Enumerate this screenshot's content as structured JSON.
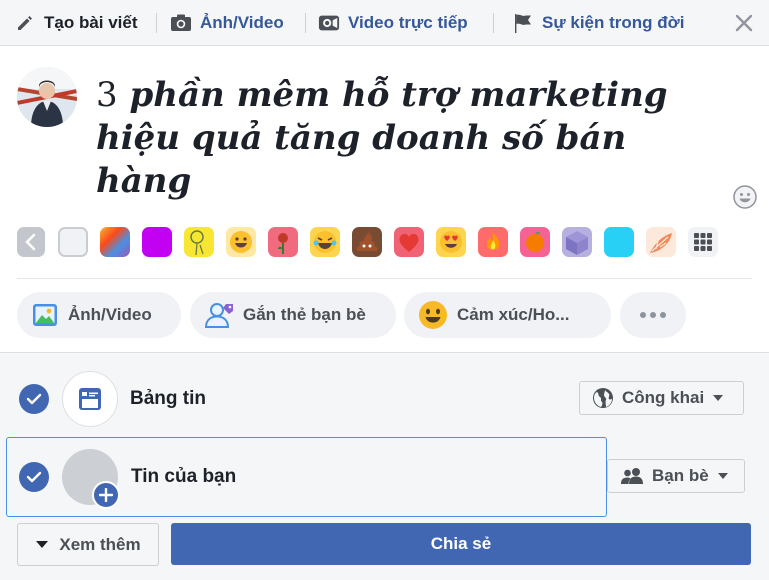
{
  "tabs": {
    "create_post": "Tạo bài viết",
    "photo_video": "Ảnh/Video",
    "live_video": "Video trực tiếp",
    "life_event": "Sự kiện trong đời"
  },
  "post": {
    "number": "3",
    "text": "phần mêm hỗ trợ marketing hiệu quả tăng doanh số bán hàng"
  },
  "backgrounds": [
    "back-arrow",
    "plain-white",
    "colorful-wave",
    "purple",
    "yellow-balloon",
    "smile-emoji",
    "rose",
    "laughing-emoji",
    "poop-emoji",
    "red-heart",
    "heart-eyes-emoji",
    "fire",
    "orange-fruit",
    "purple-cube",
    "cyan",
    "peach-leaf",
    "grid-more"
  ],
  "actions": {
    "photo_video": "Ảnh/Video",
    "tag_friends": "Gắn thẻ bạn bè",
    "feeling": "Cảm xúc/Ho..."
  },
  "destinations": {
    "news_feed": "Bảng tin",
    "your_story": "Tin của bạn"
  },
  "audience": {
    "feed": "Công khai",
    "story": "Bạn bè"
  },
  "buttons": {
    "see_more": "Xem thêm",
    "share": "Chia sẻ"
  },
  "colors": {
    "accent": "#4267b2",
    "link": "#365899"
  }
}
